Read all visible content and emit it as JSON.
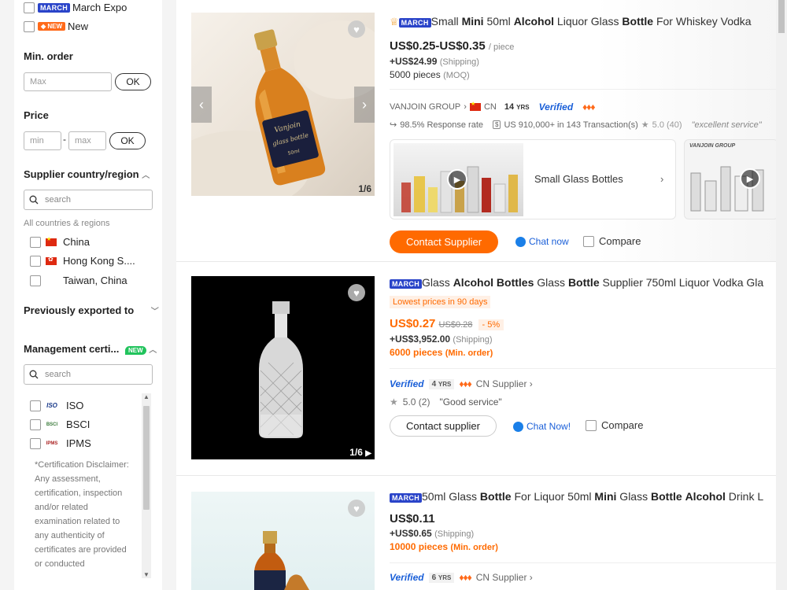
{
  "sidebar": {
    "trade_show": {
      "badge": "MARCH",
      "label": "March Expo"
    },
    "new_filter": {
      "badge": "NEW",
      "label": "New"
    },
    "min_order": {
      "title": "Min. order",
      "placeholder": "Max",
      "ok": "OK"
    },
    "price": {
      "title": "Price",
      "min_placeholder": "min",
      "separator": "-",
      "max_placeholder": "max",
      "ok": "OK"
    },
    "country": {
      "title": "Supplier country/region",
      "search_placeholder": "search",
      "all_label": "All countries & regions",
      "items": [
        {
          "label": "China"
        },
        {
          "label": "Hong Kong S...."
        },
        {
          "label": "Taiwan, China"
        }
      ]
    },
    "exported": {
      "title": "Previously exported to"
    },
    "certification": {
      "title": "Management certi...",
      "badge": "NEW",
      "search_placeholder": "search",
      "items": [
        {
          "logo": "ISO",
          "label": "ISO"
        },
        {
          "logo": "BSCI",
          "label": "BSCI"
        },
        {
          "logo": "IPMS",
          "label": "IPMS"
        }
      ],
      "disclaimer": "*Certification Disclaimer: Any assessment, certification, inspection and/or related examination related to any authenticity of certificates are provided or conducted"
    }
  },
  "products": [
    {
      "badge": "MARCH",
      "title_parts": [
        {
          "t": "Small ",
          "b": false
        },
        {
          "t": "Mini",
          "b": true
        },
        {
          "t": " 50ml ",
          "b": false
        },
        {
          "t": "Alcohol",
          "b": true
        },
        {
          "t": " Liquor Glass ",
          "b": false
        },
        {
          "t": "Bottle",
          "b": true
        },
        {
          "t": " For Whiskey Vodka",
          "b": false
        }
      ],
      "price": "US$0.25-US$0.35",
      "price_unit": "/ piece",
      "shipping": "+US$24.99",
      "shipping_label": "(Shipping)",
      "moq": "5000 pieces",
      "moq_label": "(MOQ)",
      "supplier": "VANJOIN GROUP",
      "country": "CN",
      "years": "14",
      "years_unit": "YRS",
      "verified": "Verified",
      "response_rate": "98.5% Response rate",
      "transactions": "US 910,000+ in 143 Transaction(s)",
      "rating": "5.0 (40)",
      "review": "\"excellent service\"",
      "image_label": "Vanjoin glass bottle",
      "image_sub": "50ml",
      "image_count": "1/6",
      "video_card_label": "Small Glass Bottles",
      "video_card2_label": "VANJOIN GROUP",
      "contact": "Contact Supplier",
      "chat": "Chat now",
      "compare": "Compare"
    },
    {
      "badge": "MARCH",
      "title_parts": [
        {
          "t": "Glass ",
          "b": false
        },
        {
          "t": "Alcohol Bottles",
          "b": true
        },
        {
          "t": " Glass ",
          "b": false
        },
        {
          "t": "Bottle",
          "b": true
        },
        {
          "t": " Supplier 750ml Liquor Vodka Gla",
          "b": false
        }
      ],
      "promo": "Lowest prices in 90 days",
      "price": "US$0.27",
      "old_price": "US$0.28",
      "discount": "- 5%",
      "shipping": "+US$3,952.00",
      "shipping_label": "(Shipping)",
      "moq": "6000 pieces",
      "moq_label": "(Min. order)",
      "verified": "Verified",
      "years": "4",
      "years_unit": "YRS",
      "supplier_link": "CN Supplier",
      "rating": "5.0 (2)",
      "review": "\"Good service\"",
      "image_count": "1/6",
      "contact": "Contact supplier",
      "chat": "Chat Now!",
      "compare": "Compare"
    },
    {
      "badge": "MARCH",
      "title_parts": [
        {
          "t": "50ml Glass ",
          "b": false
        },
        {
          "t": "Bottle",
          "b": true
        },
        {
          "t": " For Liquor 50ml ",
          "b": false
        },
        {
          "t": "Mini",
          "b": true
        },
        {
          "t": " Glass ",
          "b": false
        },
        {
          "t": "Bottle",
          "b": true
        },
        {
          "t": " ",
          "b": false
        },
        {
          "t": "Alcohol",
          "b": true
        },
        {
          "t": " Drink L",
          "b": false
        }
      ],
      "price": "US$0.11",
      "shipping": "+US$0.65",
      "shipping_label": "(Shipping)",
      "moq": "10000 pieces",
      "moq_label": "(Min. order)",
      "verified": "Verified",
      "years": "6",
      "years_unit": "YRS",
      "supplier_link": "CN Supplier"
    }
  ],
  "colors": {
    "accent": "#ff6a00",
    "link": "#1a5fd8",
    "march_badge": "#2a44c9"
  }
}
